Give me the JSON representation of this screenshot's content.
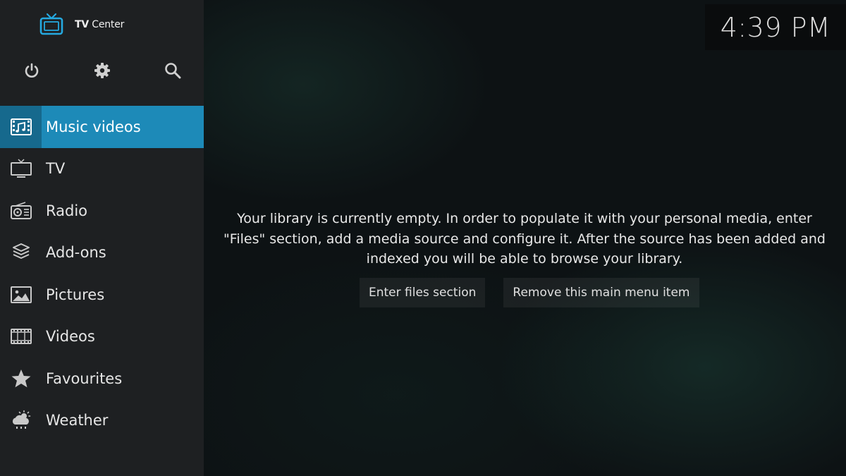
{
  "app": {
    "brand_bold": "TV",
    "brand_rest": "Center"
  },
  "clock": {
    "time": "4:39 PM"
  },
  "top_actions": [
    {
      "icon": "power-icon"
    },
    {
      "icon": "gear-icon"
    },
    {
      "icon": "search-icon"
    }
  ],
  "menu": {
    "items": [
      {
        "label": "Music videos",
        "icon": "music-video-icon",
        "active": true
      },
      {
        "label": "TV",
        "icon": "tv-icon"
      },
      {
        "label": "Radio",
        "icon": "radio-icon"
      },
      {
        "label": "Add-ons",
        "icon": "addons-box-icon"
      },
      {
        "label": "Pictures",
        "icon": "pictures-icon"
      },
      {
        "label": "Videos",
        "icon": "film-strip-icon"
      },
      {
        "label": "Favourites",
        "icon": "star-icon"
      },
      {
        "label": "Weather",
        "icon": "weather-icon"
      }
    ]
  },
  "main": {
    "message_line1": "Your library is currently empty. In order to populate it with your personal media, enter",
    "message_line2": "\"Files\" section, add a media source and configure it. After the source has been added and",
    "message_line3": "indexed you will be able to browse your library.",
    "enter_files_label": "Enter files section",
    "remove_item_label": "Remove this main menu item"
  },
  "colors": {
    "accent": "#1d8ab8",
    "accent_dark": "#16698d",
    "sidebar_bg": "#1e2022",
    "background": "#0d1214"
  }
}
